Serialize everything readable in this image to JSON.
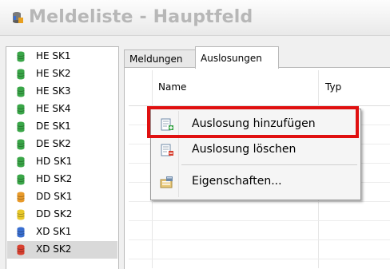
{
  "window": {
    "title": "Meldeliste - Hauptfeld",
    "icon": "database-app-icon"
  },
  "sidebar": {
    "items": [
      {
        "label": "HE SK1",
        "color": "#3aa648"
      },
      {
        "label": "HE SK2",
        "color": "#3aa648"
      },
      {
        "label": "HE SK3",
        "color": "#3aa648"
      },
      {
        "label": "HE SK4",
        "color": "#3aa648"
      },
      {
        "label": "DE SK1",
        "color": "#3aa648"
      },
      {
        "label": "DE SK2",
        "color": "#3aa648"
      },
      {
        "label": "HD SK1",
        "color": "#3aa648"
      },
      {
        "label": "HD SK2",
        "color": "#3aa648"
      },
      {
        "label": "DD SK1",
        "color": "#e89a2a"
      },
      {
        "label": "DD SK2",
        "color": "#e8c82a"
      },
      {
        "label": "XD SK1",
        "color": "#3a6fd0"
      },
      {
        "label": "XD SK2",
        "color": "#d84030",
        "selected": true
      }
    ]
  },
  "tabs": [
    {
      "label": "Meldungen",
      "active": false
    },
    {
      "label": "Auslosungen",
      "active": true
    }
  ],
  "grid": {
    "columns": [
      "Name",
      "Typ"
    ]
  },
  "context_menu": {
    "items": [
      {
        "label": "Auslosung hinzufügen",
        "icon": "add-document-icon"
      },
      {
        "label": "Auslosung löschen",
        "icon": "delete-document-icon"
      },
      {
        "label": "Eigenschaften...",
        "icon": "properties-icon"
      }
    ]
  },
  "colors": {
    "highlight": "#e01010",
    "selection": "#d9d9d9"
  }
}
